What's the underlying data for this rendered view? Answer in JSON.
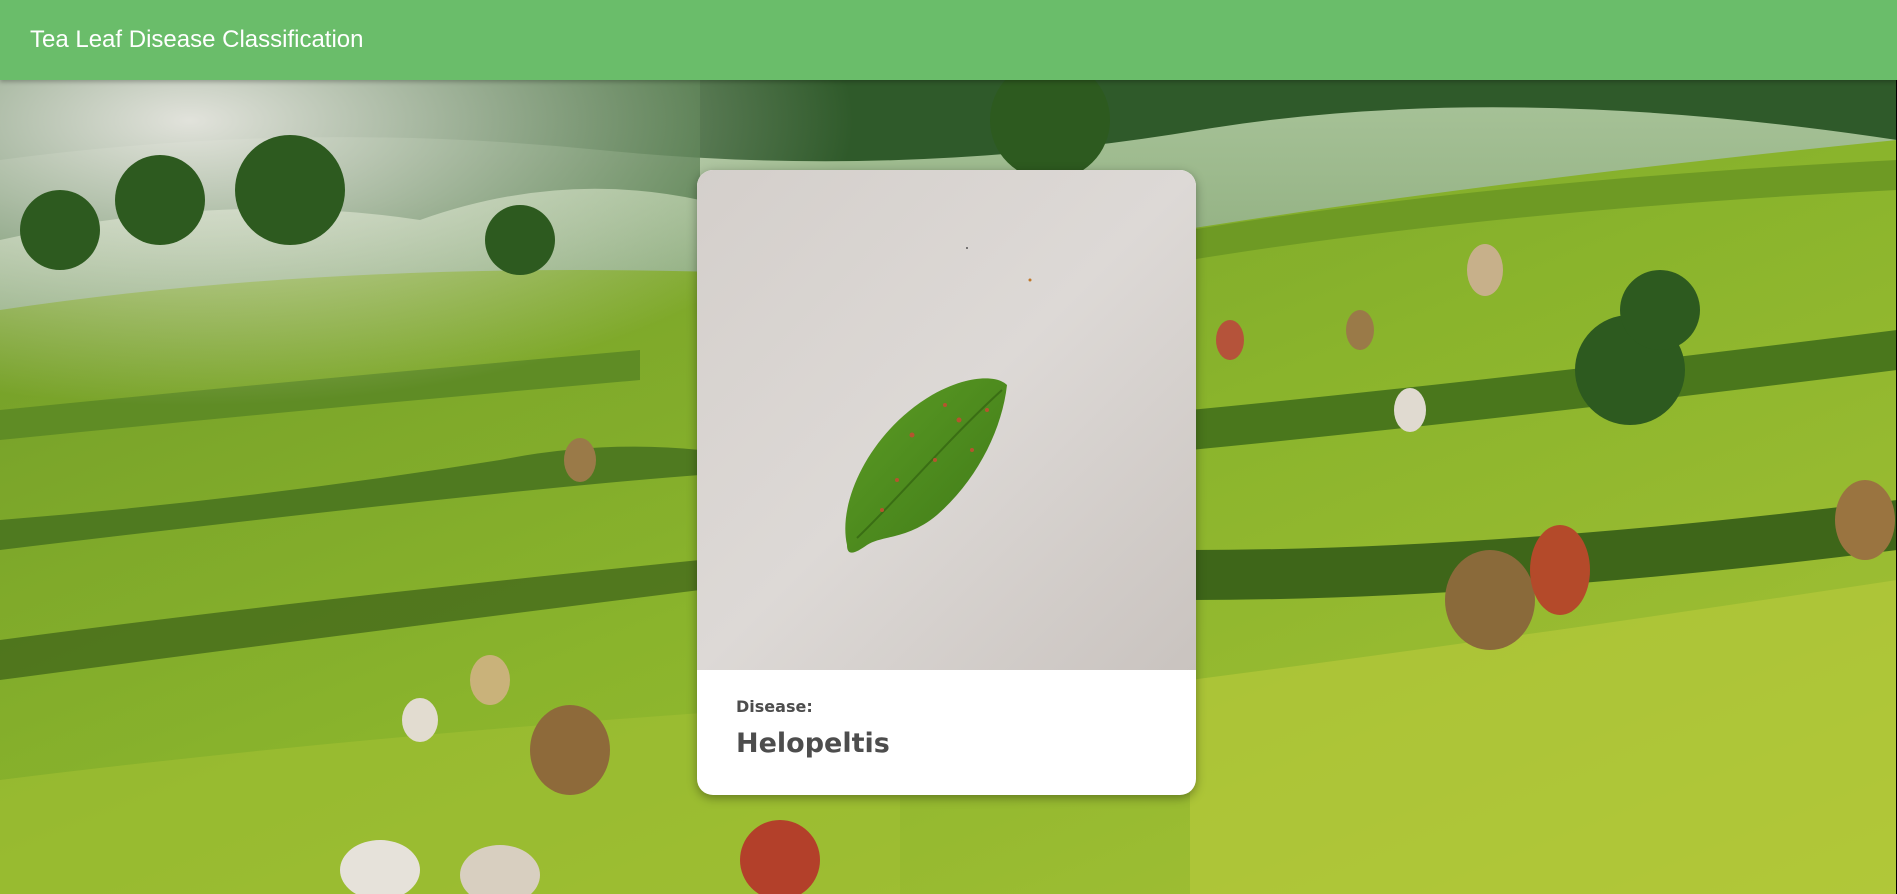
{
  "app": {
    "title": "Tea Leaf Disease Classification"
  },
  "result": {
    "label": "Disease:",
    "value": "Helopeltis"
  },
  "colors": {
    "appbar": "#6abd6a",
    "card": "#ffffff",
    "text": "#4d4d4d"
  },
  "icons": {
    "background": "tea-plantation-image",
    "sample": "tea-leaf-photo"
  }
}
